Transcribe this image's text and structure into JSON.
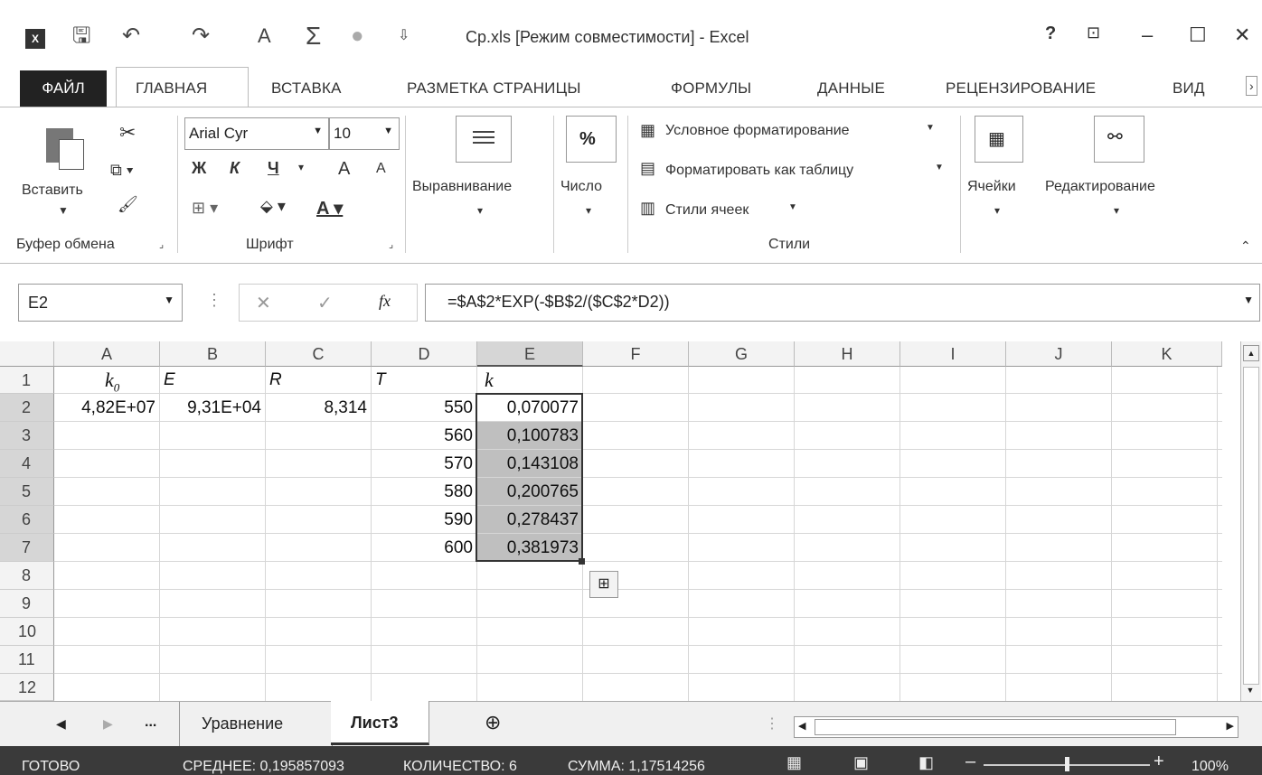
{
  "window": {
    "title": "Ср.xls  [Режим совместимости] - Excel",
    "help": "?",
    "minimize": "–",
    "maximize": "☐",
    "close": "✕"
  },
  "tabs": [
    "ФАЙЛ",
    "ГЛАВНАЯ",
    "ВСТАВКА",
    "РАЗМЕТКА СТРАНИЦЫ",
    "ФОРМУЛЫ",
    "ДАННЫЕ",
    "РЕЦЕНЗИРОВАНИЕ",
    "ВИД"
  ],
  "ribbon": {
    "paste_label": "Вставить",
    "clipboard_group": "Буфер обмена",
    "font_name": "Arial Cyr",
    "font_size": "10",
    "bold": "Ж",
    "italic": "К",
    "underline": "Ч",
    "grow_font": "A",
    "shrink_font": "A",
    "font_group": "Шрифт",
    "alignment_label": "Выравнивание",
    "number_label": "Число",
    "number_symbol": "%",
    "cond_format": "Условное форматирование",
    "format_table": "Форматировать как таблицу",
    "cell_styles": "Стили ячеек",
    "styles_group": "Стили",
    "cells_label": "Ячейки",
    "editing_label": "Редактирование"
  },
  "formula_bar": {
    "name_box": "E2",
    "cancel": "✕",
    "enter": "✓",
    "fx": "fx",
    "formula": "=$A$2*EXP(-$B$2/($C$2*D2))"
  },
  "columns": [
    "A",
    "B",
    "C",
    "D",
    "E",
    "F",
    "G",
    "H",
    "I",
    "J",
    "K"
  ],
  "rows": [
    "1",
    "2",
    "3",
    "4",
    "5",
    "6",
    "7",
    "8",
    "9",
    "10",
    "11",
    "12"
  ],
  "cells": {
    "A1": "k",
    "A1_sub": "0",
    "B1": "E",
    "C1": "R",
    "D1": "T",
    "E1": "k",
    "A2": "4,82E+07",
    "B2": "9,31E+04",
    "C2": "8,314",
    "D2": "550",
    "E2": "0,070077",
    "D3": "560",
    "E3": "0,100783",
    "D4": "570",
    "E4": "0,143108",
    "D5": "580",
    "E5": "0,200765",
    "D6": "590",
    "E6": "0,278437",
    "D7": "600",
    "E7": "0,381973"
  },
  "sheet_tabs": {
    "ellipsis": "...",
    "sheet1": "Уравнение",
    "sheet2": "Лист3",
    "add": "⊕"
  },
  "status": {
    "ready": "ГОТОВО",
    "average": "СРЕДНЕЕ: 0,195857093",
    "count": "КОЛИЧЕСТВО: 6",
    "sum": "СУММА: 1,17514256",
    "zoom": "100%",
    "zoom_level": 1.0
  }
}
